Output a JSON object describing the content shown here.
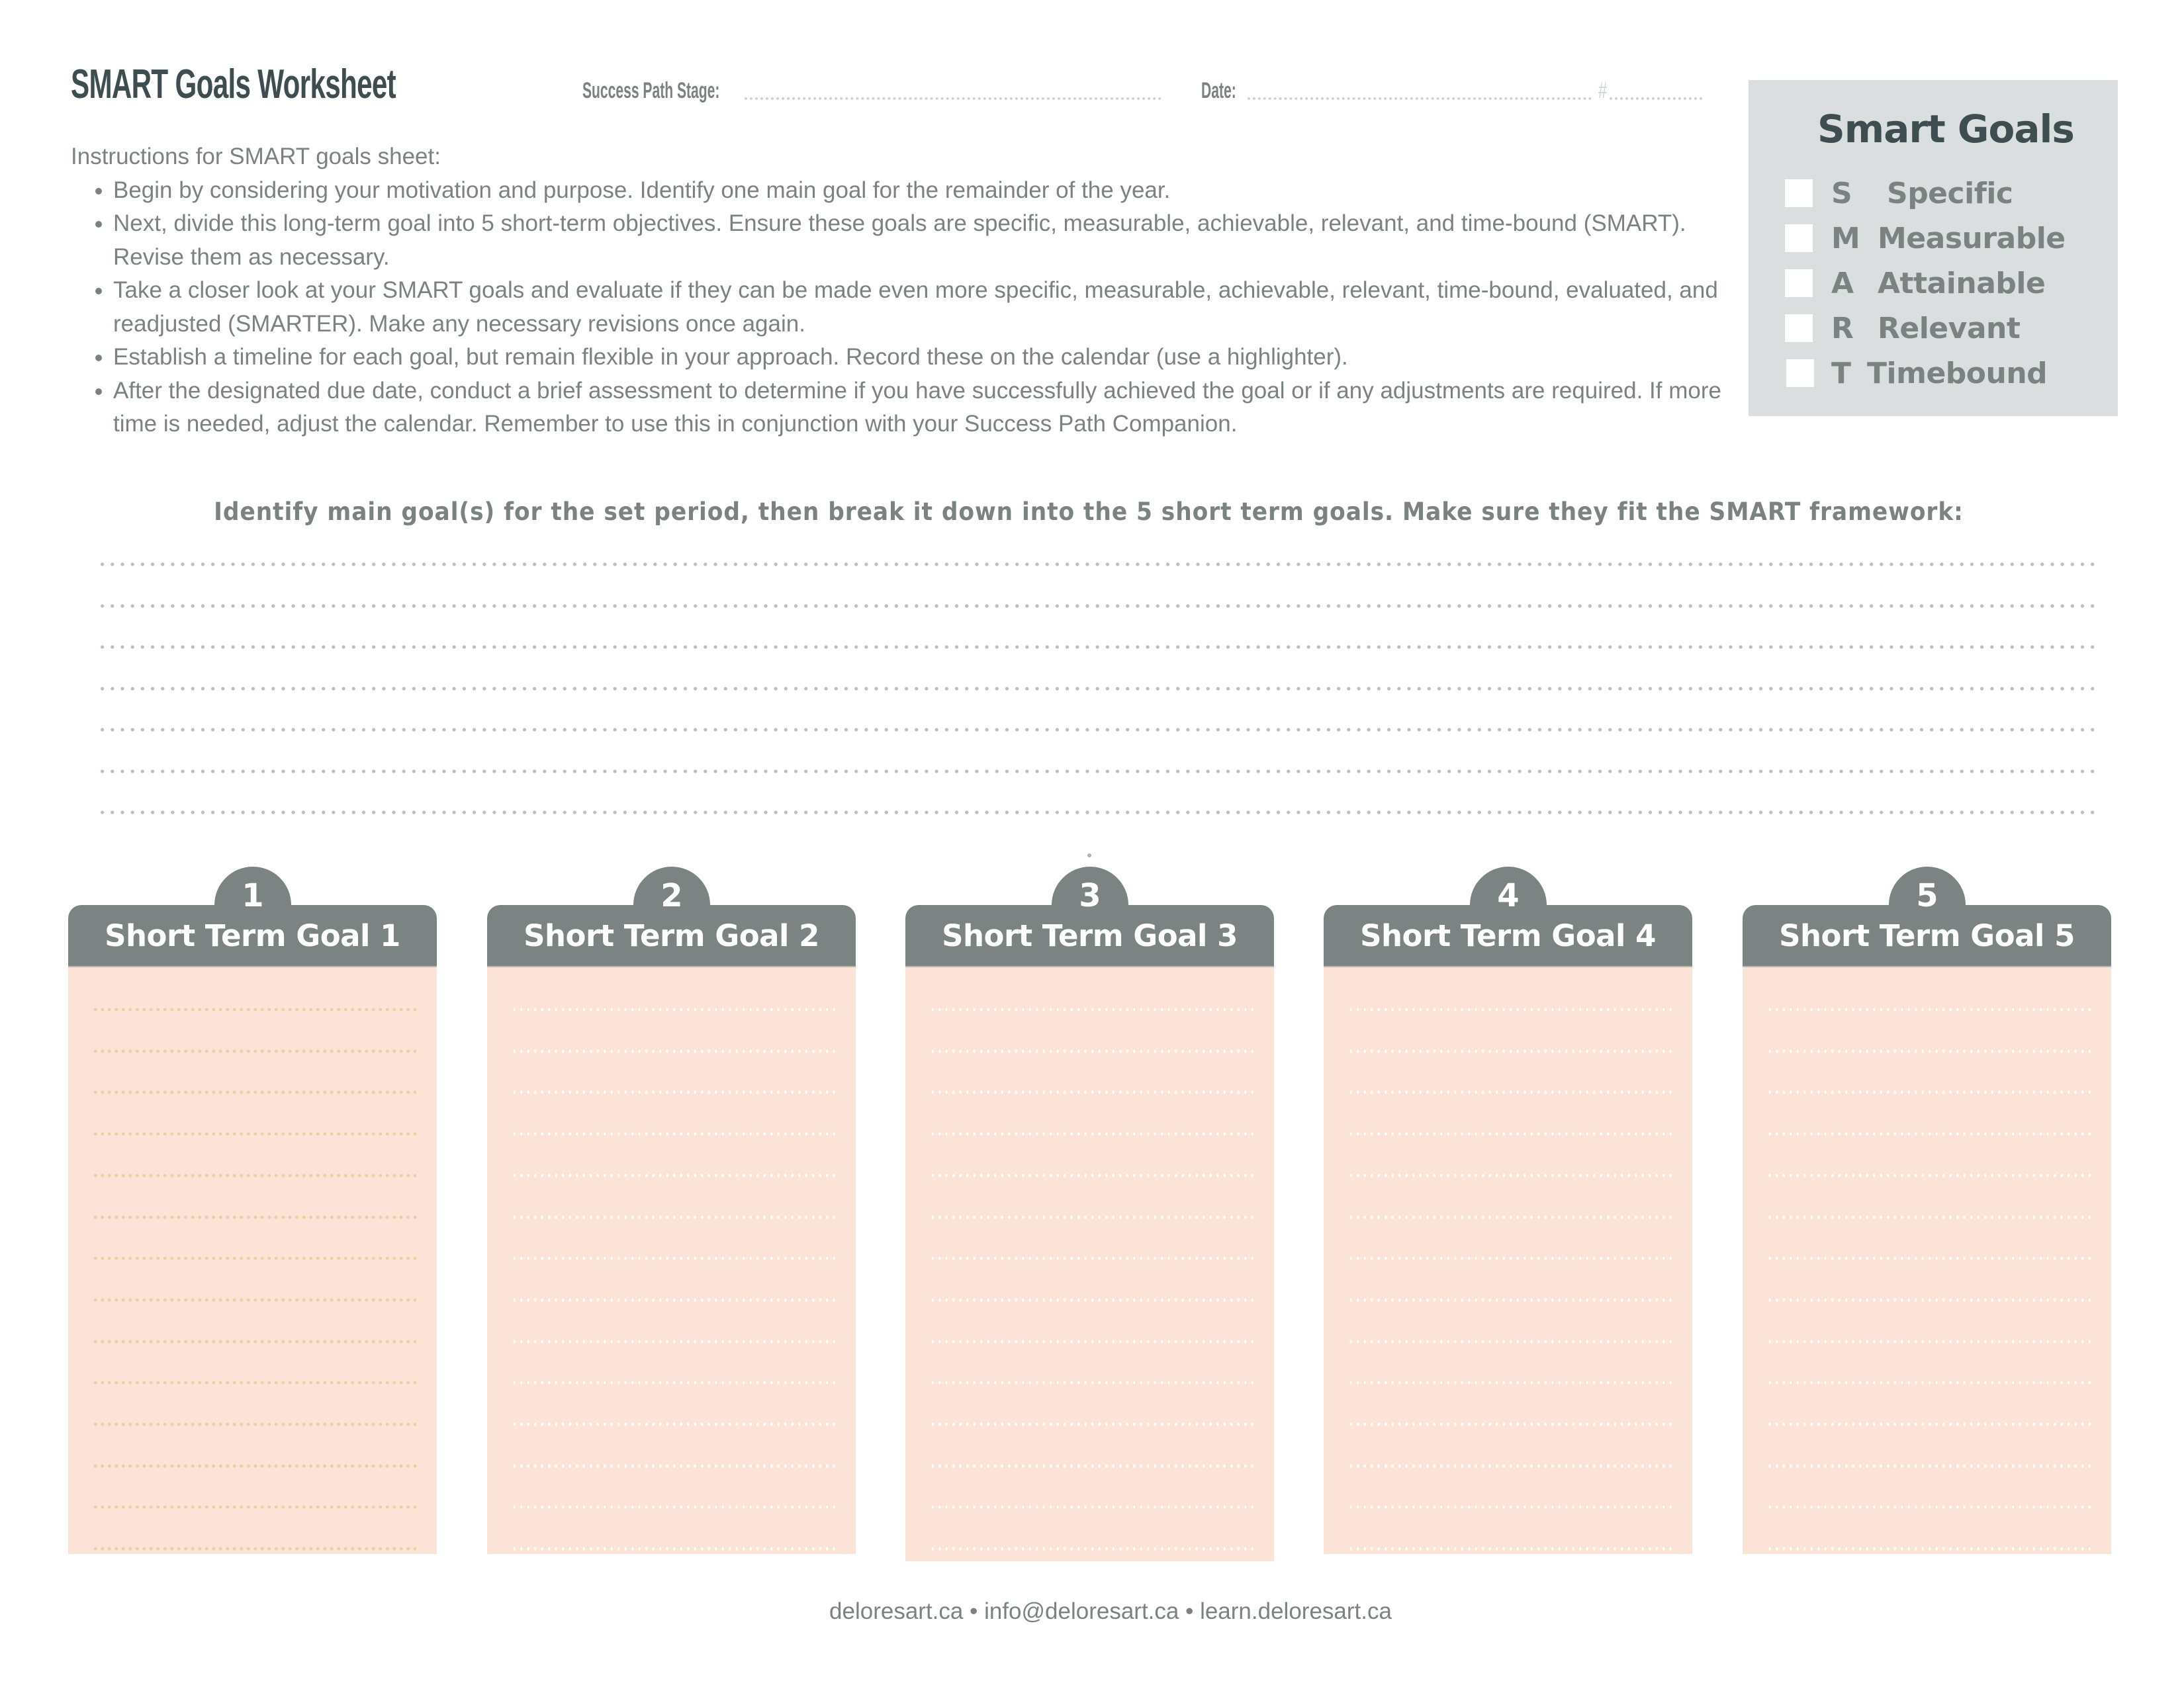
{
  "header": {
    "title": "SMART Goals Worksheet",
    "success_path_label": "Success Path Stage:",
    "success_path_value": "",
    "date_label": "Date:",
    "date_value": "",
    "number_label": "#",
    "number_value": ""
  },
  "instructions": {
    "heading": "Instructions for SMART goals sheet:",
    "items": [
      "Begin by considering your motivation and purpose. Identify one main goal for the remainder of the year.",
      "Next, divide this long-term goal into 5 short-term objectives. Ensure these goals are specific, measurable, achievable, relevant, and time-bound (SMART). Revise them as necessary.",
      "Take a closer look at your SMART goals and evaluate if they can be made even more specific, measurable, achievable, relevant, time-bound, evaluated, and readjusted (SMARTER). Make any necessary revisions once again.",
      "Establish a timeline for each goal, but remain flexible in your approach. Record these on the calendar (use a highlighter).",
      "After the designated due date, conduct a brief assessment to determine if you have successfully achieved the goal or if any adjustments are required. If more time is needed, adjust the calendar. Remember to use this in conjunction with your Success Path Companion."
    ]
  },
  "smart_box": {
    "title": "Smart Goals",
    "items": [
      {
        "letter": "S",
        "word": "Specific",
        "checked": false
      },
      {
        "letter": "M",
        "word": "Measurable",
        "checked": false
      },
      {
        "letter": "A",
        "word": "Attainable",
        "checked": false
      },
      {
        "letter": "R",
        "word": "Relevant",
        "checked": false
      },
      {
        "letter": "T",
        "word": "Timebound",
        "checked": false
      }
    ]
  },
  "main_goal": {
    "prompt": "Identify main goal(s) for the set period, then break it down into the 5 short term goals. Make sure they fit the SMART framework:",
    "line_count": 7
  },
  "short_term_goals": [
    {
      "number": "1",
      "title": "Short Term Goal 1",
      "line_count": 14
    },
    {
      "number": "2",
      "title": "Short Term Goal 2",
      "line_count": 14
    },
    {
      "number": "3",
      "title": "Short Term Goal 3",
      "line_count": 14
    },
    {
      "number": "4",
      "title": "Short Term Goal 4",
      "line_count": 14
    },
    {
      "number": "5",
      "title": "Short Term Goal 5",
      "line_count": 14
    }
  ],
  "colors": {
    "header_gray": "#7b8482",
    "card_body": "#fce3d8",
    "text_gray": "#7a8380",
    "title_dark": "#3e4d50",
    "smart_box_bg": "#dadedf"
  },
  "footer": {
    "text": "deloresart.ca • info@deloresart.ca • learn.deloresart.ca"
  }
}
